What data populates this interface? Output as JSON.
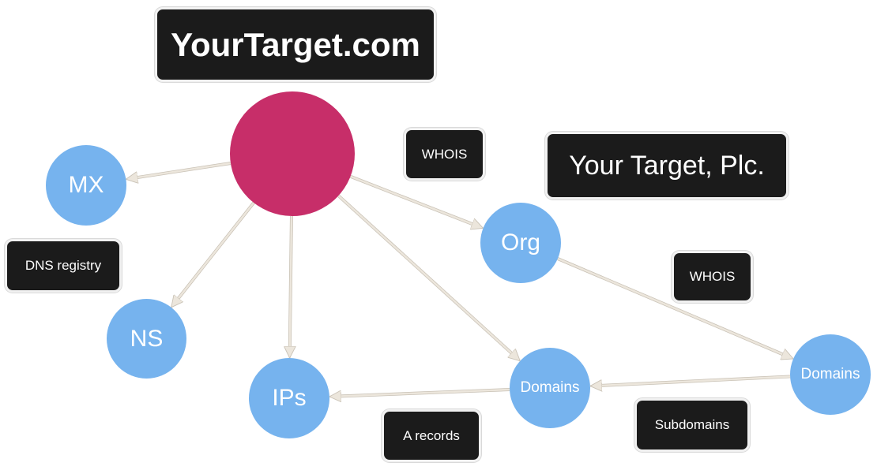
{
  "diagram": {
    "title": "YourTarget.com",
    "organization_label": "Your Target, Plc.",
    "colors": {
      "root_node": "#c72e69",
      "child_node": "#76b3ee",
      "edge": "#ece6dc",
      "label_bg": "#1b1b1b",
      "label_text": "#ffffff"
    },
    "nodes": [
      {
        "id": "root",
        "label": ""
      },
      {
        "id": "mx",
        "label": "MX"
      },
      {
        "id": "ns",
        "label": "NS"
      },
      {
        "id": "ips",
        "label": "IPs"
      },
      {
        "id": "domains1",
        "label": "Domains"
      },
      {
        "id": "org",
        "label": "Org"
      },
      {
        "id": "domains2",
        "label": "Domains"
      }
    ],
    "edges": [
      {
        "from": "root",
        "to": "mx"
      },
      {
        "from": "root",
        "to": "ns"
      },
      {
        "from": "root",
        "to": "ips"
      },
      {
        "from": "root",
        "to": "domains1"
      },
      {
        "from": "root",
        "to": "org"
      },
      {
        "from": "org",
        "to": "domains2"
      },
      {
        "from": "domains2",
        "to": "domains1"
      },
      {
        "from": "domains1",
        "to": "ips"
      }
    ],
    "edge_labels": {
      "whois_root_org": "WHOIS",
      "dns_registry": "DNS registry",
      "whois_org_domains": "WHOIS",
      "a_records": "A records",
      "subdomains": "Subdomains"
    }
  }
}
